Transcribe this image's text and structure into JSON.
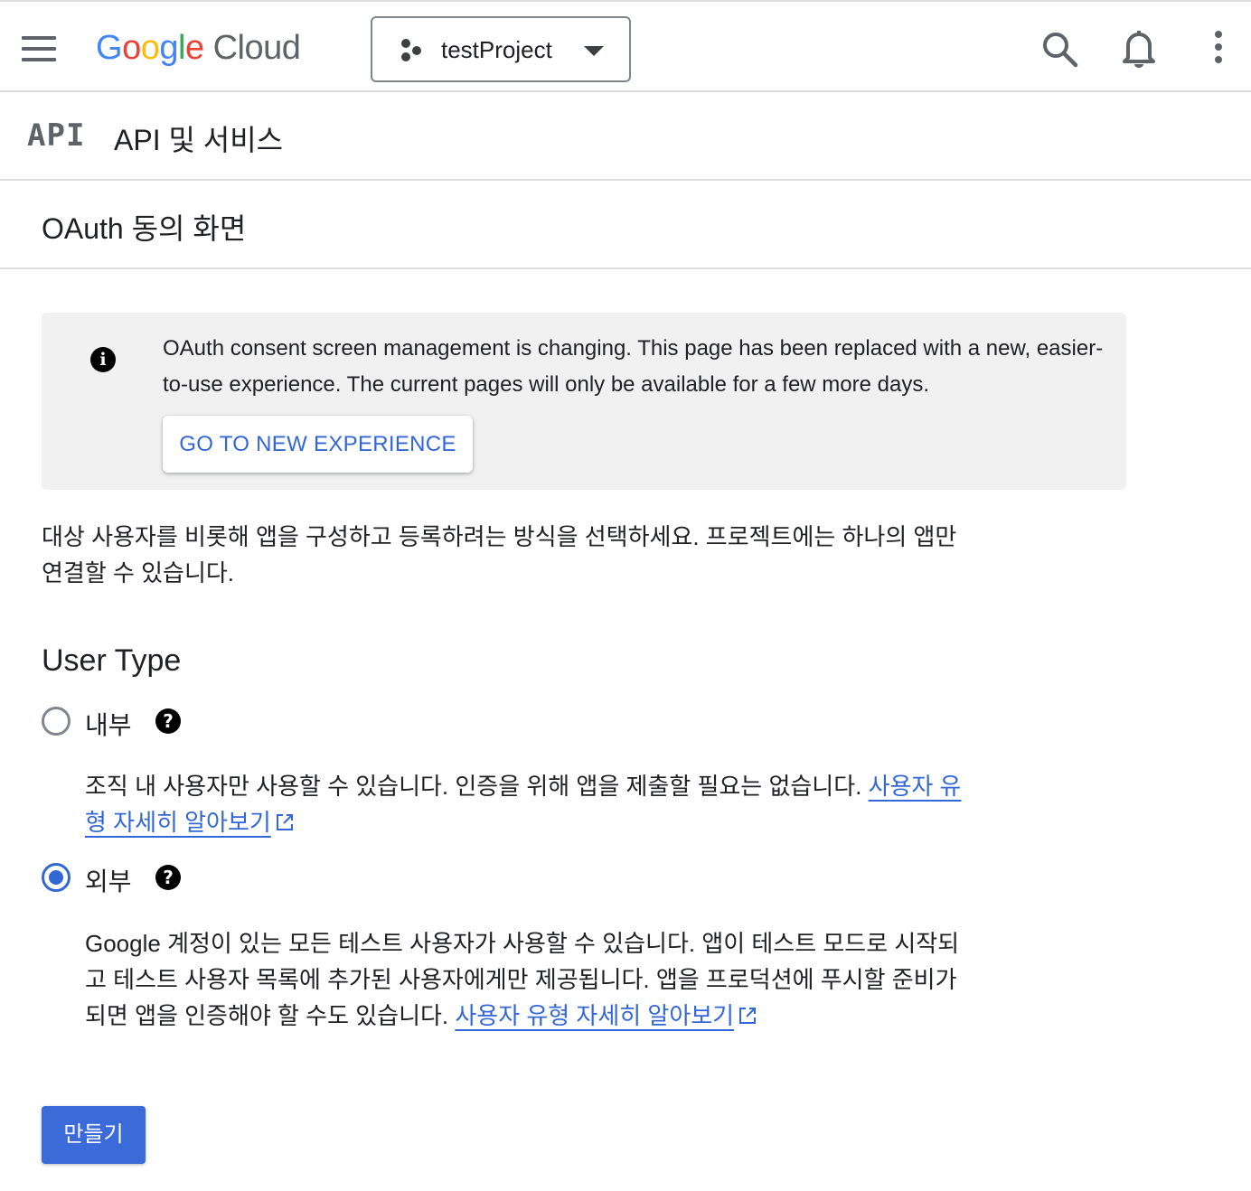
{
  "topbar": {
    "logo_google": [
      "G",
      "o",
      "o",
      "g",
      "l",
      "e"
    ],
    "logo_cloud": "Cloud",
    "project_name": "testProject"
  },
  "api_header": {
    "badge": "API",
    "title": "API 및 서비스"
  },
  "page": {
    "title": "OAuth 동의 화면"
  },
  "notice": {
    "text": "OAuth consent screen management is changing. This page has been replaced with a new, easier-to-use experience. The current pages will only be available for a few more days.",
    "button_label": "GO TO NEW EXPERIENCE"
  },
  "intro": "대상 사용자를 비롯해 앱을 구성하고 등록하려는 방식을 선택하세요. 프로젝트에는 하나의 앱만 연결할 수 있습니다.",
  "user_type": {
    "heading": "User Type",
    "internal": {
      "label": "내부",
      "selected": false,
      "description": "조직 내 사용자만 사용할 수 있습니다. 인증을 위해 앱을 제출할 필요는 없습니다. ",
      "link": "사용자 유형 자세히 알아보기"
    },
    "external": {
      "label": "외부",
      "selected": true,
      "description": "Google 계정이 있는 모든 테스트 사용자가 사용할 수 있습니다. 앱이 테스트 모드로 시작되고 테스트 사용자 목록에 추가된 사용자에게만 제공됩니다. 앱을 프로덕션에 푸시할 준비가 되면 앱을 인증해야 할 수도 있습니다. ",
      "link": "사용자 유형 자세히 알아보기"
    }
  },
  "create_button": "만들기",
  "colors": {
    "accent": "#3367d6",
    "button_primary": "#3b6ad9",
    "notice_bg": "#f1f1f1",
    "divider": "#dadce0"
  },
  "icons": [
    "menu-icon",
    "project-icon",
    "dropdown-icon",
    "search-icon",
    "bell-icon",
    "more-icon",
    "info-icon",
    "help-icon",
    "external-link-icon"
  ]
}
